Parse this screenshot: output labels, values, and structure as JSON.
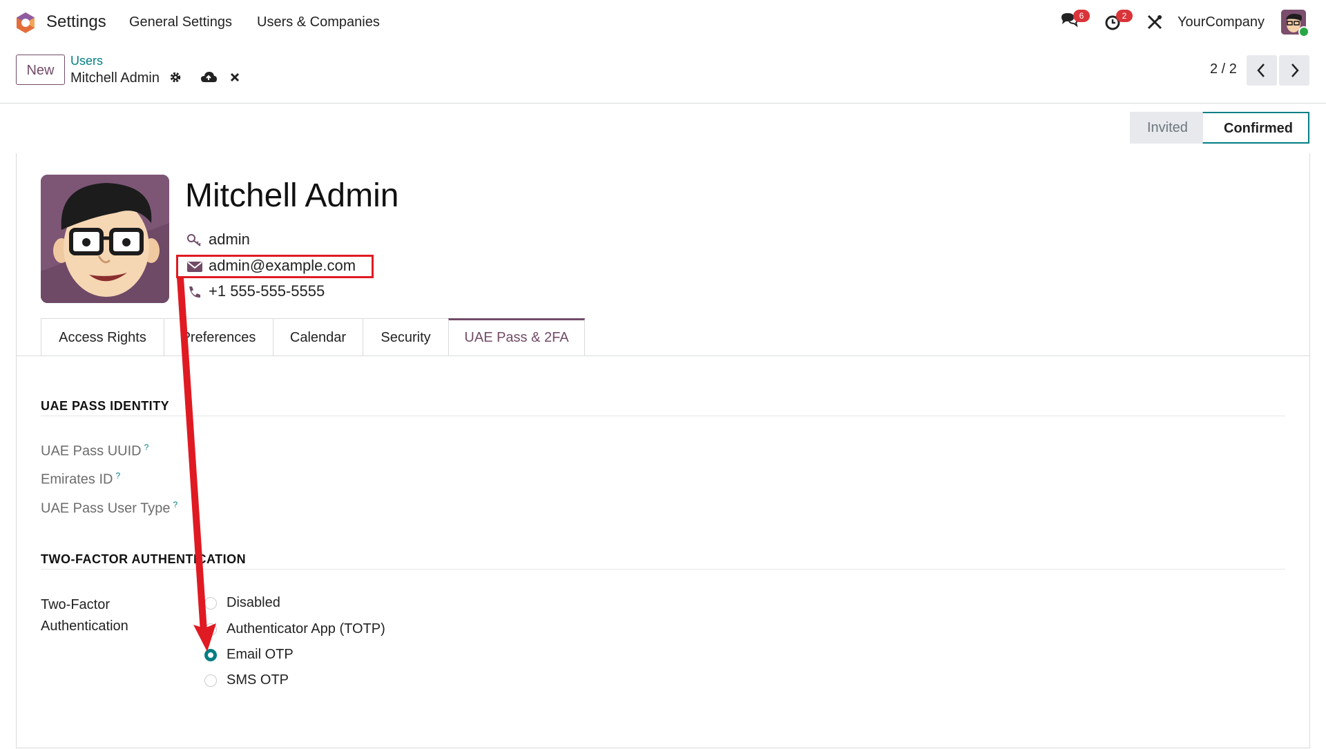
{
  "navbar": {
    "app_name": "Settings",
    "menu": [
      "General Settings",
      "Users & Companies"
    ],
    "messages_count": "6",
    "activities_count": "2",
    "company": "YourCompany"
  },
  "control_panel": {
    "new_label": "New",
    "breadcrumb_parent": "Users",
    "breadcrumb_current": "Mitchell Admin",
    "pager": "2 / 2"
  },
  "status": {
    "stages": [
      "Invited",
      "Confirmed"
    ],
    "current": "Confirmed"
  },
  "user": {
    "name": "Mitchell Admin",
    "login": "admin",
    "email": "admin@example.com",
    "phone": "+1 555-555-5555"
  },
  "tabs": [
    "Access Rights",
    "Preferences",
    "Calendar",
    "Security",
    "UAE Pass & 2FA"
  ],
  "active_tab": "UAE Pass & 2FA",
  "uae_pass": {
    "section_title": "UAE PASS IDENTITY",
    "fields": [
      "UAE Pass UUID",
      "Emirates ID",
      "UAE Pass User Type"
    ],
    "help_mark": "?"
  },
  "two_factor": {
    "section_title": "TWO-FACTOR AUTHENTICATION",
    "label_line1": "Two-Factor",
    "label_line2": "Authentication",
    "options": [
      "Disabled",
      "Authenticator App (TOTP)",
      "Email OTP",
      "SMS OTP"
    ],
    "selected": "Email OTP"
  },
  "colors": {
    "primary": "#714b67",
    "teal": "#017e84",
    "annotation": "#e01a22"
  }
}
